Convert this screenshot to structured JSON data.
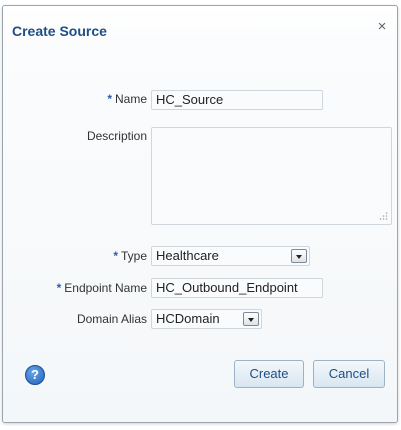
{
  "dialog": {
    "title": "Create Source",
    "close_glyph": "×"
  },
  "form": {
    "required_marker": "*",
    "name": {
      "label": "Name",
      "value": "HC_Source",
      "required": true
    },
    "description": {
      "label": "Description",
      "value": ""
    },
    "type": {
      "label": "Type",
      "value": "Healthcare",
      "required": true
    },
    "endpoint_name": {
      "label": "Endpoint Name",
      "value": "HC_Outbound_Endpoint",
      "required": true
    },
    "domain_alias": {
      "label": "Domain Alias",
      "value": "HCDomain"
    }
  },
  "footer": {
    "help_glyph": "?",
    "create_label": "Create",
    "cancel_label": "Cancel"
  },
  "icons": {
    "close": "close-icon",
    "help": "help-icon",
    "dropdown": "chevron-down-icon",
    "resize": "resize-grip-icon"
  },
  "colors": {
    "title": "#1f4e84",
    "required_marker": "#2a5da8",
    "help_icon": "#1f5fb8"
  }
}
